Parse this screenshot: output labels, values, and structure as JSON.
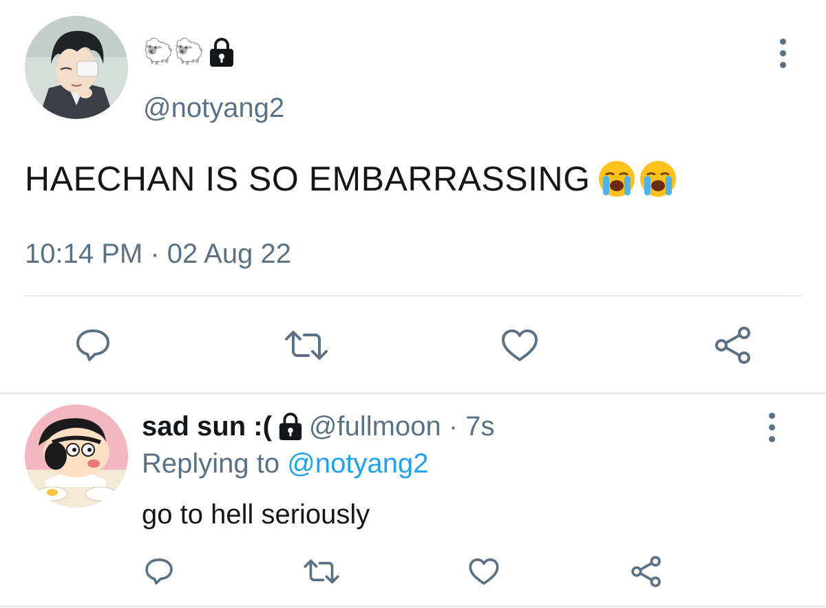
{
  "main_tweet": {
    "display_name_emoji": "🐑🐑",
    "handle": "@notyang2",
    "text": "HAECHAN IS SO EMBARRASSING",
    "text_emoji": "loudly-crying-face x2",
    "timestamp": "10:14 PM · 02 Aug 22",
    "locked": true,
    "actions": [
      "reply-icon",
      "retweet-icon",
      "like-icon",
      "share-icon"
    ]
  },
  "reply_tweet": {
    "display_name": "sad sun :(",
    "handle_time": "@fullmoon · 7s",
    "replying_label": "Replying to",
    "replying_mention": "@notyang2",
    "text": "go to hell seriously",
    "locked": true,
    "actions": [
      "reply-icon",
      "retweet-icon",
      "like-icon",
      "share-icon"
    ]
  },
  "colors": {
    "secondary_text": "#5b7083",
    "link": "#1da1f2",
    "primary_text": "#14171a",
    "divider": "#e1e8ed"
  }
}
